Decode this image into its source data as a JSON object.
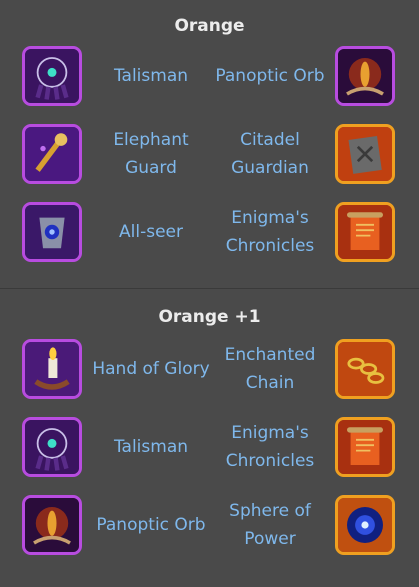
{
  "sections": [
    {
      "title": "Orange",
      "rows": [
        {
          "left": {
            "name": "Talisman",
            "icon": "talisman-icon",
            "frame": "purple"
          },
          "right": {
            "name": "Panoptic Orb",
            "icon": "panoptic-orb-icon",
            "frame": "purple"
          }
        },
        {
          "left": {
            "name": "Elephant Guard",
            "icon": "elephant-guard-icon",
            "frame": "purple"
          },
          "right": {
            "name": "Citadel Guardian",
            "icon": "citadel-guardian-icon",
            "frame": "orange"
          }
        },
        {
          "left": {
            "name": "All-seer",
            "icon": "all-seer-icon",
            "frame": "purple"
          },
          "right": {
            "name": "Enigma's Chronicles",
            "icon": "enigmas-chronicles-icon",
            "frame": "orange"
          }
        }
      ]
    },
    {
      "title": "Orange +1",
      "rows": [
        {
          "left": {
            "name": "Hand of Glory",
            "icon": "hand-of-glory-icon",
            "frame": "purple"
          },
          "right": {
            "name": "Enchanted Chain",
            "icon": "enchanted-chain-icon",
            "frame": "orange"
          }
        },
        {
          "left": {
            "name": "Talisman",
            "icon": "talisman-icon",
            "frame": "purple"
          },
          "right": {
            "name": "Enigma's Chronicles",
            "icon": "enigmas-chronicles-icon",
            "frame": "orange"
          }
        },
        {
          "left": {
            "name": "Panoptic Orb",
            "icon": "panoptic-orb-icon",
            "frame": "purple"
          },
          "right": {
            "name": "Sphere of Power",
            "icon": "sphere-of-power-icon",
            "frame": "orange"
          }
        }
      ]
    }
  ]
}
